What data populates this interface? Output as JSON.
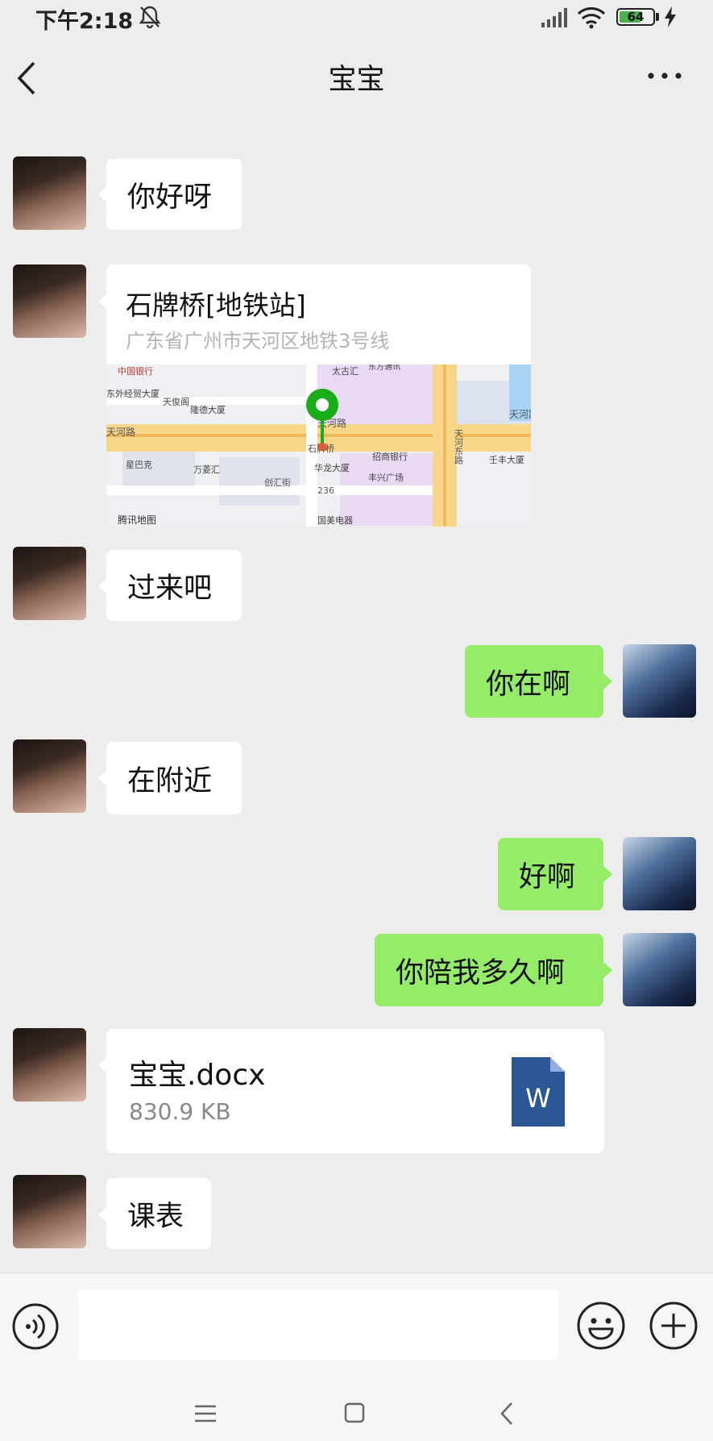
{
  "status_bar": {
    "time": "下午2:18",
    "battery": "64",
    "battery_level": 0.64
  },
  "nav": {
    "title": "宝宝",
    "back_icon": "chevron-left-icon",
    "more_icon": "more-icon"
  },
  "messages": [
    {
      "from": "other",
      "text": "你好呀"
    },
    {
      "from": "other",
      "type": "location",
      "name": "石牌桥[地铁站]",
      "address": "广东省广州市天河区地铁3号线",
      "map_labels": [
        "中国银行",
        "太古汇",
        "东方通讯",
        "东外经贸大厦",
        "天俊阁",
        "隆德大厦",
        "天河路",
        "天河路",
        "天河路",
        "天河东路",
        "星巴克",
        "万菱汇",
        "石牌桥",
        "华龙大厦",
        "招商银行",
        "丰兴广场",
        "壬丰大厦",
        "创汇街",
        "236",
        "腾讯地图",
        "国美电器"
      ]
    },
    {
      "from": "other",
      "text": "过来吧"
    },
    {
      "from": "me",
      "text": "你在啊"
    },
    {
      "from": "other",
      "text": "在附近"
    },
    {
      "from": "me",
      "text": "好啊"
    },
    {
      "from": "me",
      "text": "你陪我多久啊"
    },
    {
      "from": "other",
      "type": "file",
      "name": "宝宝.docx",
      "size": "830.9 KB",
      "icon_letter": "W"
    },
    {
      "from": "other",
      "text": "课表"
    }
  ],
  "input_bar": {
    "placeholder": "",
    "voice_icon": "voice-icon",
    "emoji_icon": "emoji-icon",
    "plus_icon": "plus-icon"
  },
  "colors": {
    "my_bubble": "#95ec69",
    "their_bubble": "#ffffff",
    "background": "#ededed",
    "word_blue": "#2b5797"
  }
}
